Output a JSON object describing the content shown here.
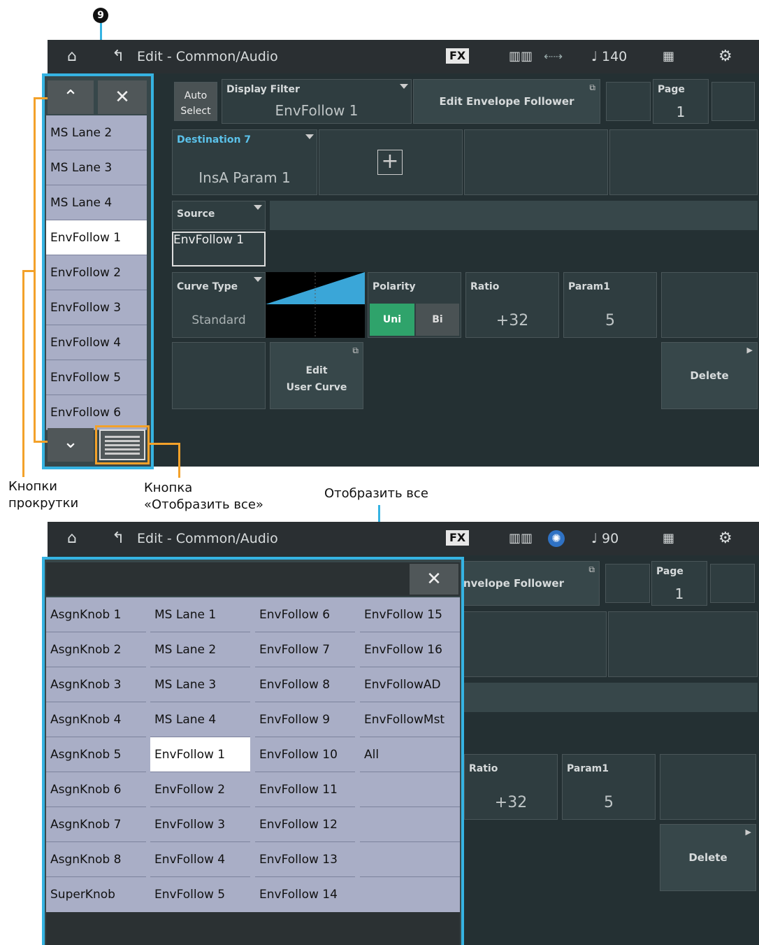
{
  "annotation": {
    "number": "9"
  },
  "screen1": {
    "nav": {
      "title": "Edit - Common/Audio",
      "fx": "FX",
      "tempo": "♩ 140"
    },
    "auto_select": [
      "Auto",
      "Select"
    ],
    "display_filter": {
      "label": "Display Filter",
      "value": "EnvFollow 1"
    },
    "edit_env_follower": "Edit Envelope Follower",
    "page": {
      "label": "Page",
      "value": "1"
    },
    "destination": {
      "label": "Destination 7",
      "value": "InsA Param 1"
    },
    "source": {
      "label": "Source",
      "value": "EnvFollow 1"
    },
    "curve_type": {
      "label": "Curve Type",
      "value": "Standard"
    },
    "polarity": {
      "label": "Polarity",
      "uni": "Uni",
      "bi": "Bi"
    },
    "ratio": {
      "label": "Ratio",
      "value": "+32"
    },
    "param1": {
      "label": "Param1",
      "value": "5"
    },
    "edit_user_curve": [
      "Edit",
      "User Curve"
    ],
    "delete": "Delete",
    "list": [
      "MS Lane 2",
      "MS Lane 3",
      "MS Lane 4",
      "EnvFollow 1",
      "EnvFollow 2",
      "EnvFollow 3",
      "EnvFollow 4",
      "EnvFollow 5",
      "EnvFollow 6"
    ],
    "selected_index": 3
  },
  "captions": {
    "scroll_buttons": [
      "Кнопки",
      "прокрутки"
    ],
    "show_all_button": [
      "Кнопка",
      "«Отобразить все»"
    ],
    "show_all": "Отобразить все"
  },
  "screen2": {
    "nav": {
      "title": "Edit - Common/Audio",
      "fx": "FX",
      "tempo": "♩ 90"
    },
    "edit_env_follower": "Envelope Follower",
    "page": {
      "label": "Page",
      "value": "1"
    },
    "ratio": {
      "label": "Ratio",
      "value": "+32"
    },
    "param1": {
      "label": "Param1",
      "value": "5"
    },
    "delete": "Delete",
    "columns": [
      [
        "AsgnKnob 1",
        "AsgnKnob 2",
        "AsgnKnob 3",
        "AsgnKnob 4",
        "AsgnKnob 5",
        "AsgnKnob 6",
        "AsgnKnob 7",
        "AsgnKnob 8",
        "SuperKnob"
      ],
      [
        "MS Lane 1",
        "MS Lane 2",
        "MS Lane 3",
        "MS Lane 4",
        "EnvFollow 1",
        "EnvFollow 2",
        "EnvFollow 3",
        "EnvFollow 4",
        "EnvFollow 5"
      ],
      [
        "EnvFollow 6",
        "EnvFollow 7",
        "EnvFollow 8",
        "EnvFollow 9",
        "EnvFollow 10",
        "EnvFollow 11",
        "EnvFollow 12",
        "EnvFollow 13",
        "EnvFollow 14"
      ],
      [
        "EnvFollow 15",
        "EnvFollow 16",
        "EnvFollowAD",
        "EnvFollowMst",
        "All",
        "",
        "",
        "",
        ""
      ]
    ],
    "selected": "EnvFollow 1"
  }
}
